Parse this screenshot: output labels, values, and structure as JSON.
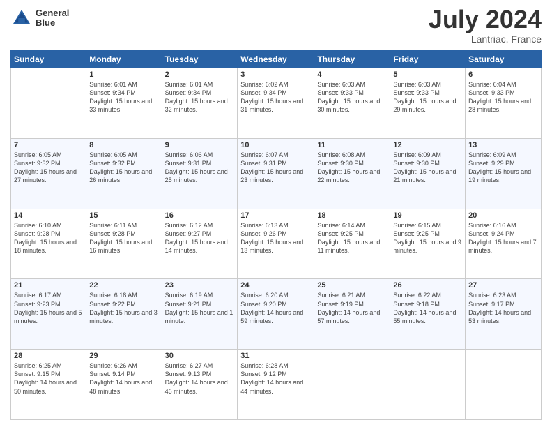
{
  "logo": {
    "line1": "General",
    "line2": "Blue"
  },
  "title": "July 2024",
  "location": "Lantriac, France",
  "days_of_week": [
    "Sunday",
    "Monday",
    "Tuesday",
    "Wednesday",
    "Thursday",
    "Friday",
    "Saturday"
  ],
  "weeks": [
    [
      {
        "day": "",
        "sunrise": "",
        "sunset": "",
        "daylight": ""
      },
      {
        "day": "1",
        "sunrise": "Sunrise: 6:01 AM",
        "sunset": "Sunset: 9:34 PM",
        "daylight": "Daylight: 15 hours and 33 minutes."
      },
      {
        "day": "2",
        "sunrise": "Sunrise: 6:01 AM",
        "sunset": "Sunset: 9:34 PM",
        "daylight": "Daylight: 15 hours and 32 minutes."
      },
      {
        "day": "3",
        "sunrise": "Sunrise: 6:02 AM",
        "sunset": "Sunset: 9:34 PM",
        "daylight": "Daylight: 15 hours and 31 minutes."
      },
      {
        "day": "4",
        "sunrise": "Sunrise: 6:03 AM",
        "sunset": "Sunset: 9:33 PM",
        "daylight": "Daylight: 15 hours and 30 minutes."
      },
      {
        "day": "5",
        "sunrise": "Sunrise: 6:03 AM",
        "sunset": "Sunset: 9:33 PM",
        "daylight": "Daylight: 15 hours and 29 minutes."
      },
      {
        "day": "6",
        "sunrise": "Sunrise: 6:04 AM",
        "sunset": "Sunset: 9:33 PM",
        "daylight": "Daylight: 15 hours and 28 minutes."
      }
    ],
    [
      {
        "day": "7",
        "sunrise": "Sunrise: 6:05 AM",
        "sunset": "Sunset: 9:32 PM",
        "daylight": "Daylight: 15 hours and 27 minutes."
      },
      {
        "day": "8",
        "sunrise": "Sunrise: 6:05 AM",
        "sunset": "Sunset: 9:32 PM",
        "daylight": "Daylight: 15 hours and 26 minutes."
      },
      {
        "day": "9",
        "sunrise": "Sunrise: 6:06 AM",
        "sunset": "Sunset: 9:31 PM",
        "daylight": "Daylight: 15 hours and 25 minutes."
      },
      {
        "day": "10",
        "sunrise": "Sunrise: 6:07 AM",
        "sunset": "Sunset: 9:31 PM",
        "daylight": "Daylight: 15 hours and 23 minutes."
      },
      {
        "day": "11",
        "sunrise": "Sunrise: 6:08 AM",
        "sunset": "Sunset: 9:30 PM",
        "daylight": "Daylight: 15 hours and 22 minutes."
      },
      {
        "day": "12",
        "sunrise": "Sunrise: 6:09 AM",
        "sunset": "Sunset: 9:30 PM",
        "daylight": "Daylight: 15 hours and 21 minutes."
      },
      {
        "day": "13",
        "sunrise": "Sunrise: 6:09 AM",
        "sunset": "Sunset: 9:29 PM",
        "daylight": "Daylight: 15 hours and 19 minutes."
      }
    ],
    [
      {
        "day": "14",
        "sunrise": "Sunrise: 6:10 AM",
        "sunset": "Sunset: 9:28 PM",
        "daylight": "Daylight: 15 hours and 18 minutes."
      },
      {
        "day": "15",
        "sunrise": "Sunrise: 6:11 AM",
        "sunset": "Sunset: 9:28 PM",
        "daylight": "Daylight: 15 hours and 16 minutes."
      },
      {
        "day": "16",
        "sunrise": "Sunrise: 6:12 AM",
        "sunset": "Sunset: 9:27 PM",
        "daylight": "Daylight: 15 hours and 14 minutes."
      },
      {
        "day": "17",
        "sunrise": "Sunrise: 6:13 AM",
        "sunset": "Sunset: 9:26 PM",
        "daylight": "Daylight: 15 hours and 13 minutes."
      },
      {
        "day": "18",
        "sunrise": "Sunrise: 6:14 AM",
        "sunset": "Sunset: 9:25 PM",
        "daylight": "Daylight: 15 hours and 11 minutes."
      },
      {
        "day": "19",
        "sunrise": "Sunrise: 6:15 AM",
        "sunset": "Sunset: 9:25 PM",
        "daylight": "Daylight: 15 hours and 9 minutes."
      },
      {
        "day": "20",
        "sunrise": "Sunrise: 6:16 AM",
        "sunset": "Sunset: 9:24 PM",
        "daylight": "Daylight: 15 hours and 7 minutes."
      }
    ],
    [
      {
        "day": "21",
        "sunrise": "Sunrise: 6:17 AM",
        "sunset": "Sunset: 9:23 PM",
        "daylight": "Daylight: 15 hours and 5 minutes."
      },
      {
        "day": "22",
        "sunrise": "Sunrise: 6:18 AM",
        "sunset": "Sunset: 9:22 PM",
        "daylight": "Daylight: 15 hours and 3 minutes."
      },
      {
        "day": "23",
        "sunrise": "Sunrise: 6:19 AM",
        "sunset": "Sunset: 9:21 PM",
        "daylight": "Daylight: 15 hours and 1 minute."
      },
      {
        "day": "24",
        "sunrise": "Sunrise: 6:20 AM",
        "sunset": "Sunset: 9:20 PM",
        "daylight": "Daylight: 14 hours and 59 minutes."
      },
      {
        "day": "25",
        "sunrise": "Sunrise: 6:21 AM",
        "sunset": "Sunset: 9:19 PM",
        "daylight": "Daylight: 14 hours and 57 minutes."
      },
      {
        "day": "26",
        "sunrise": "Sunrise: 6:22 AM",
        "sunset": "Sunset: 9:18 PM",
        "daylight": "Daylight: 14 hours and 55 minutes."
      },
      {
        "day": "27",
        "sunrise": "Sunrise: 6:23 AM",
        "sunset": "Sunset: 9:17 PM",
        "daylight": "Daylight: 14 hours and 53 minutes."
      }
    ],
    [
      {
        "day": "28",
        "sunrise": "Sunrise: 6:25 AM",
        "sunset": "Sunset: 9:15 PM",
        "daylight": "Daylight: 14 hours and 50 minutes."
      },
      {
        "day": "29",
        "sunrise": "Sunrise: 6:26 AM",
        "sunset": "Sunset: 9:14 PM",
        "daylight": "Daylight: 14 hours and 48 minutes."
      },
      {
        "day": "30",
        "sunrise": "Sunrise: 6:27 AM",
        "sunset": "Sunset: 9:13 PM",
        "daylight": "Daylight: 14 hours and 46 minutes."
      },
      {
        "day": "31",
        "sunrise": "Sunrise: 6:28 AM",
        "sunset": "Sunset: 9:12 PM",
        "daylight": "Daylight: 14 hours and 44 minutes."
      },
      {
        "day": "",
        "sunrise": "",
        "sunset": "",
        "daylight": ""
      },
      {
        "day": "",
        "sunrise": "",
        "sunset": "",
        "daylight": ""
      },
      {
        "day": "",
        "sunrise": "",
        "sunset": "",
        "daylight": ""
      }
    ]
  ]
}
